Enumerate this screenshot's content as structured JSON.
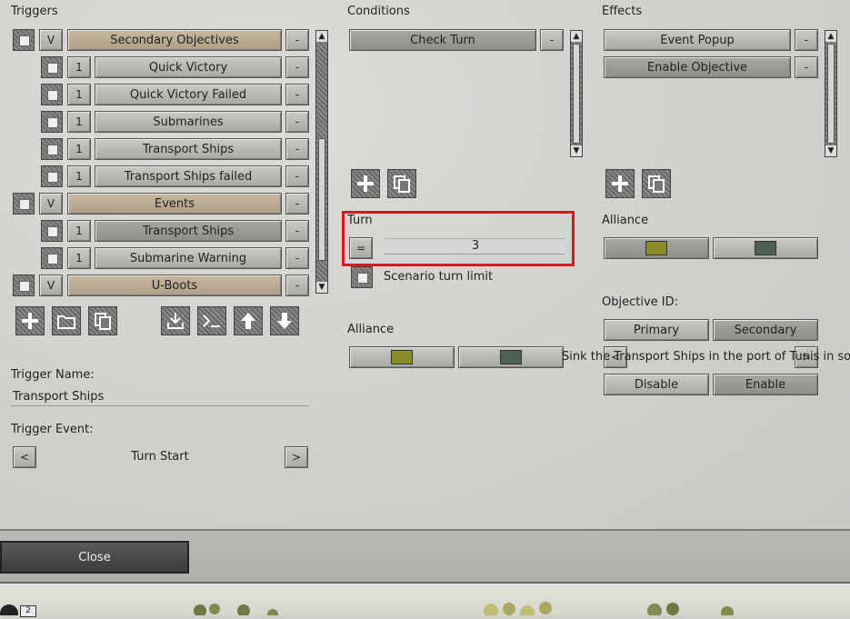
{
  "triggers": {
    "header": "Triggers",
    "rows": [
      {
        "level": 0,
        "flag": "V",
        "label": "Secondary Objectives",
        "style": "tan"
      },
      {
        "level": 1,
        "flag": "1",
        "label": "Quick Victory",
        "style": "grey"
      },
      {
        "level": 1,
        "flag": "1",
        "label": "Quick Victory Failed",
        "style": "grey"
      },
      {
        "level": 1,
        "flag": "1",
        "label": "Submarines",
        "style": "grey"
      },
      {
        "level": 1,
        "flag": "1",
        "label": "Transport Ships",
        "style": "grey"
      },
      {
        "level": 1,
        "flag": "1",
        "label": "Transport Ships failed",
        "style": "grey"
      },
      {
        "level": 0,
        "flag": "V",
        "label": "Events",
        "style": "tan"
      },
      {
        "level": 1,
        "flag": "1",
        "label": "Transport Ships",
        "style": "dark"
      },
      {
        "level": 1,
        "flag": "1",
        "label": "Submarine Warning",
        "style": "grey"
      },
      {
        "level": 0,
        "flag": "V",
        "label": "U-Boots",
        "style": "tan"
      }
    ],
    "remove_label": "-"
  },
  "trigger_name": {
    "label": "Trigger Name:",
    "value": "Transport Ships"
  },
  "trigger_event": {
    "label": "Trigger Event:",
    "value": "Turn Start",
    "prev": "<",
    "next": ">"
  },
  "conditions": {
    "header": "Conditions",
    "items": [
      {
        "label": "Check Turn"
      }
    ],
    "remove_label": "-"
  },
  "turn": {
    "label": "Turn",
    "operator": "=",
    "value": "3",
    "limit_label": "Scenario turn limit"
  },
  "condition_alliance": {
    "label": "Alliance",
    "colors": [
      "#8b8c2a",
      "#4f5f55"
    ]
  },
  "effects": {
    "header": "Effects",
    "items": [
      {
        "label": "Event Popup"
      },
      {
        "label": "Enable Objective"
      }
    ],
    "remove_label": "-"
  },
  "effect_alliance": {
    "label": "Alliance",
    "colors": [
      "#8b8c2a",
      "#4f5f55"
    ]
  },
  "objective": {
    "label": "Objective ID:",
    "primary": "Primary",
    "secondary": "Secondary",
    "text": "Sink the Transport Ships in the port of Tunis in so turns.",
    "prev": "<",
    "next": ">",
    "disable": "Disable",
    "enable": "Enable"
  },
  "close_label": "Close",
  "badge": "2",
  "colors": {
    "tan": "#bfae94",
    "highlight": "#d8171c"
  }
}
